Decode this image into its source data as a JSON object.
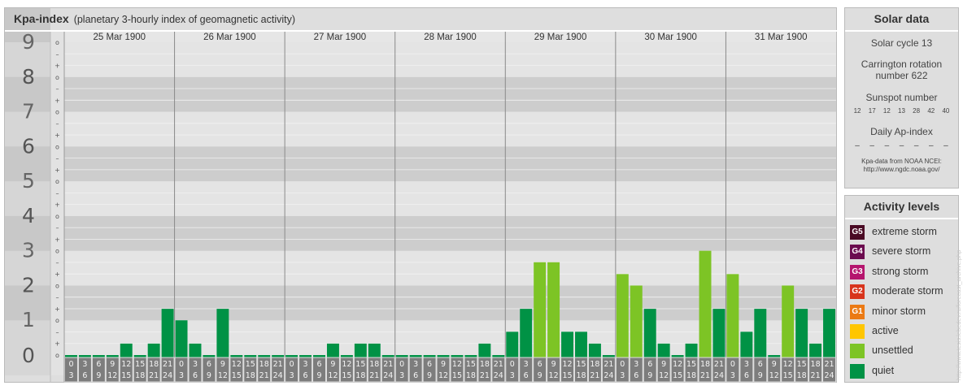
{
  "header": {
    "title": "Kpa-index",
    "subtitle": "(planetary 3-hourly index of geomagnetic activity)"
  },
  "chart_data": {
    "type": "bar",
    "title": "Kpa-index",
    "subtitle": "(planetary 3-hourly index of geomagnetic activity)",
    "ylim": [
      0,
      9
    ],
    "y_ticks": [
      "0",
      "1",
      "2",
      "3",
      "4",
      "5",
      "6",
      "7",
      "8",
      "9"
    ],
    "thirds_labels": [
      "+",
      "o",
      "–"
    ],
    "days": [
      "25 Mar 1900",
      "26 Mar 1900",
      "27 Mar 1900",
      "28 Mar 1900",
      "29 Mar 1900",
      "30 Mar 1900",
      "31 Mar 1900"
    ],
    "hour_bins": [
      [
        "0",
        "3"
      ],
      [
        "3",
        "6"
      ],
      [
        "6",
        "9"
      ],
      [
        "9",
        "12"
      ],
      [
        "12",
        "15"
      ],
      [
        "15",
        "18"
      ],
      [
        "18",
        "21"
      ],
      [
        "21",
        "24"
      ]
    ],
    "values": [
      [
        0,
        0,
        0,
        0,
        0.33,
        0,
        0.33,
        1.33
      ],
      [
        1,
        0.33,
        0,
        1.33,
        0,
        0,
        0,
        0
      ],
      [
        0,
        0,
        0,
        0.33,
        0,
        0.33,
        0.33,
        0
      ],
      [
        0,
        0,
        0,
        0,
        0,
        0,
        0.33,
        0
      ],
      [
        0.67,
        1.33,
        2.67,
        2.67,
        0.67,
        0.67,
        0.33,
        0
      ],
      [
        2.33,
        2,
        1.33,
        0.33,
        0,
        0.33,
        3,
        1.33
      ],
      [
        2.33,
        0.67,
        1.33,
        0,
        2,
        1.33,
        0.33,
        1.33
      ]
    ],
    "level_colors": {
      "quiet": "#009245",
      "unsettled": "#7dc425"
    },
    "legend": "side panel, right"
  },
  "solar": {
    "title": "Solar data",
    "cycle": "Solar cycle 13",
    "carrington_1": "Carrington rotation",
    "carrington_2": "number 622",
    "sunspot_title": "Sunspot number",
    "sunspots": [
      "12",
      "17",
      "12",
      "13",
      "28",
      "42",
      "40"
    ],
    "ap_title": "Daily Ap-index",
    "ap_values": [
      "–",
      "–",
      "–",
      "–",
      "–",
      "–",
      "–"
    ],
    "source_1": "Kpa-data from NOAA NCEI:",
    "source_2": "http://www.ngdc.noaa.gov/"
  },
  "activity": {
    "title": "Activity levels",
    "levels": [
      {
        "badge": "G5",
        "label": "extreme storm",
        "color": "#4a0a24"
      },
      {
        "badge": "G4",
        "label": "severe storm",
        "color": "#6b0b4f"
      },
      {
        "badge": "G3",
        "label": "strong storm",
        "color": "#b5156e"
      },
      {
        "badge": "G2",
        "label": "moderate storm",
        "color": "#d8341c"
      },
      {
        "badge": "G1",
        "label": "minor storm",
        "color": "#eb7a14"
      },
      {
        "badge": "",
        "label": "active",
        "color": "#ffc600"
      },
      {
        "badge": "",
        "label": "unsettled",
        "color": "#7dc425"
      },
      {
        "badge": "",
        "label": "quiet",
        "color": "#009245"
      }
    ]
  },
  "credit": "http://www.tesis.lebedev.ru/forecast_archive.php"
}
